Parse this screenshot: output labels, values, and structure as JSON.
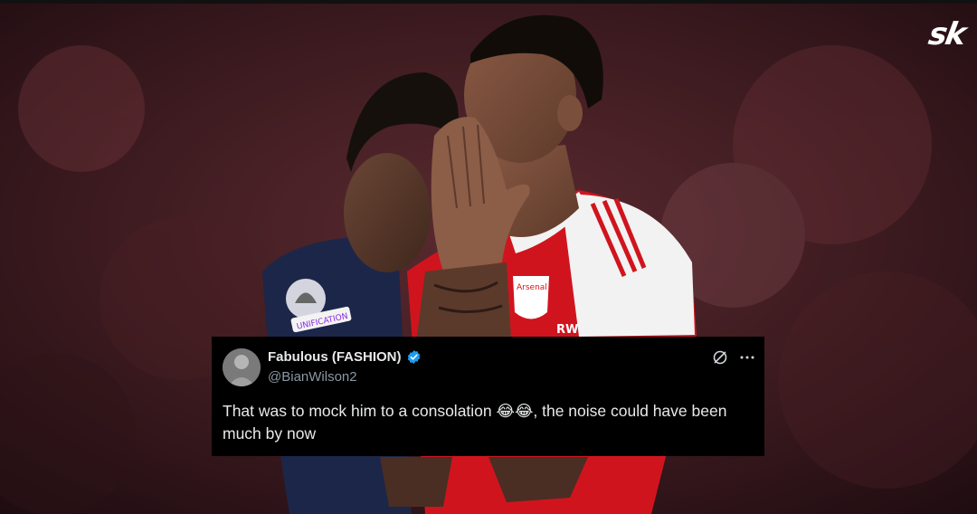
{
  "brand": {
    "logo_text": "sk"
  },
  "photo": {
    "kit_text_crest": "Arsenal",
    "kit_text_sponsor": "RW",
    "sleeve_text": "UNIFICATION"
  },
  "tweet": {
    "display_name": "Fabulous (FASHION)",
    "handle": "@BianWilson2",
    "text": "That was to mock him to a consolation 😂😂, the noise could have been much by now",
    "verified": true,
    "icons": [
      "grok-icon",
      "more-icon"
    ]
  },
  "colors": {
    "card_bg": "#000000",
    "verified": "#1d9bf0",
    "arsenal_red": "#d0141e",
    "psg_navy": "#1c2648"
  }
}
